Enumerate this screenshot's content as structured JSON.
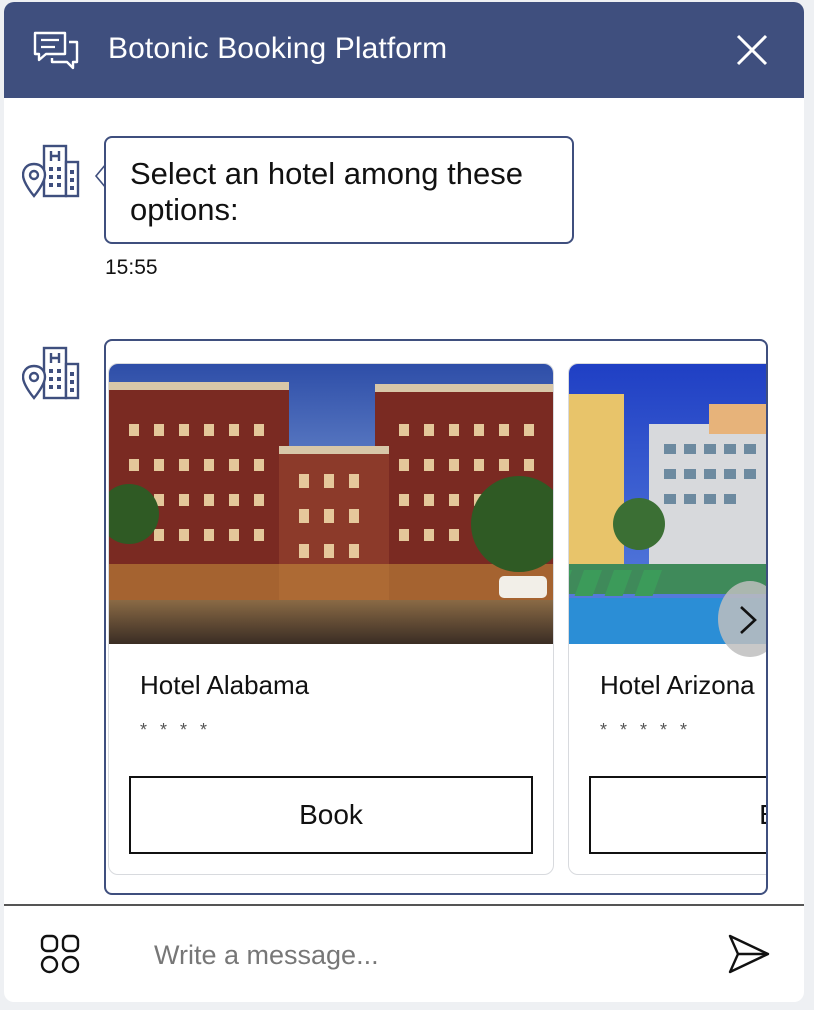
{
  "header": {
    "title": "Botonic Booking Platform",
    "chat_icon": "chat-bubbles-icon",
    "close_icon": "close-icon",
    "background": "#3f4f7e"
  },
  "messages": [
    {
      "sender_icon": "hotel-location-icon",
      "text": "Select an hotel among these options:",
      "time": "15:55"
    }
  ],
  "carousel": {
    "sender_icon": "hotel-location-icon",
    "cards": [
      {
        "name": "Hotel Alabama",
        "stars": "* * * *",
        "button_label": "Book"
      },
      {
        "name": "Hotel Arizona",
        "stars": "* * * * *",
        "button_label": "Book"
      }
    ],
    "next_icon": "chevron-right-icon"
  },
  "composer": {
    "placeholder": "Write a message...",
    "menu_icon": "grid-menu-icon",
    "send_icon": "send-icon"
  },
  "colors": {
    "accent": "#3f4f7e",
    "border": "#3f4f7e"
  }
}
